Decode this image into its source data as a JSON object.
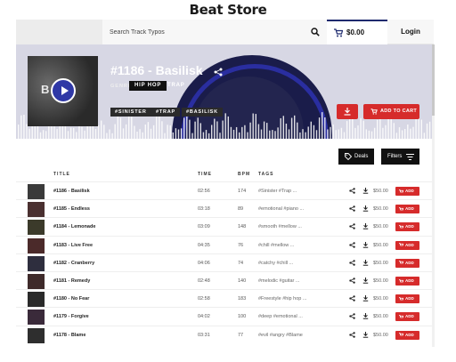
{
  "page": {
    "title": "Beat Store"
  },
  "header": {
    "search_placeholder": "Search Track Typos",
    "cart_amount": "$0.00",
    "login_label": "Login"
  },
  "hero": {
    "track_title": "#1186 - Basilisk",
    "genre_label": "GENRE",
    "genres": [
      "HIP HOP",
      "TRAP"
    ],
    "hashtags": [
      "#SINISTER",
      "#TRAP",
      "#BASILISK"
    ],
    "add_to_cart_label": "ADD TO CART",
    "cover_letters": "BK"
  },
  "controls": {
    "deals_label": "Deals",
    "filters_label": "Filters"
  },
  "table": {
    "headers": {
      "title": "TITLE",
      "time": "TIME",
      "bpm": "BPM",
      "tags": "TAGS"
    },
    "add_label": "ADD",
    "rows": [
      {
        "name": "#1186 - Basilisk",
        "time": "02:56",
        "bpm": "174",
        "tags": "#Sinister #Trap ...",
        "price": "$50.00"
      },
      {
        "name": "#1185 - Endless",
        "time": "03:18",
        "bpm": "89",
        "tags": "#emotional #piano ...",
        "price": "$50.00"
      },
      {
        "name": "#1184 - Lemonade",
        "time": "03:09",
        "bpm": "148",
        "tags": "#smooth #mellow ...",
        "price": "$50.00"
      },
      {
        "name": "#1183 - Live Free",
        "time": "04:35",
        "bpm": "76",
        "tags": "#chill #mellow ...",
        "price": "$50.00"
      },
      {
        "name": "#1182 - Cranberry",
        "time": "04:06",
        "bpm": "74",
        "tags": "#catchy #chill ...",
        "price": "$50.00"
      },
      {
        "name": "#1181 - Remedy",
        "time": "02:48",
        "bpm": "140",
        "tags": "#melodic #guitar ...",
        "price": "$50.00"
      },
      {
        "name": "#1180 - No Fear",
        "time": "02:58",
        "bpm": "183",
        "tags": "#Freestyle #hip hop ...",
        "price": "$50.00"
      },
      {
        "name": "#1179 - Forgive",
        "time": "04:02",
        "bpm": "100",
        "tags": "#deep #emotional ...",
        "price": "$50.00"
      },
      {
        "name": "#1178 - Blame",
        "time": "03:31",
        "bpm": "77",
        "tags": "#evil #angry #Blame",
        "price": "$50.00"
      }
    ]
  },
  "icons": {
    "search": "search-icon",
    "cart": "cart-icon",
    "share": "share-icon",
    "download": "download-icon",
    "tag": "tag-icon",
    "filter": "filter-lines-icon",
    "play": "play-icon"
  },
  "colors": {
    "accent_red": "#d62b2b",
    "navy": "#1e2a6e",
    "dark": "#111111"
  }
}
